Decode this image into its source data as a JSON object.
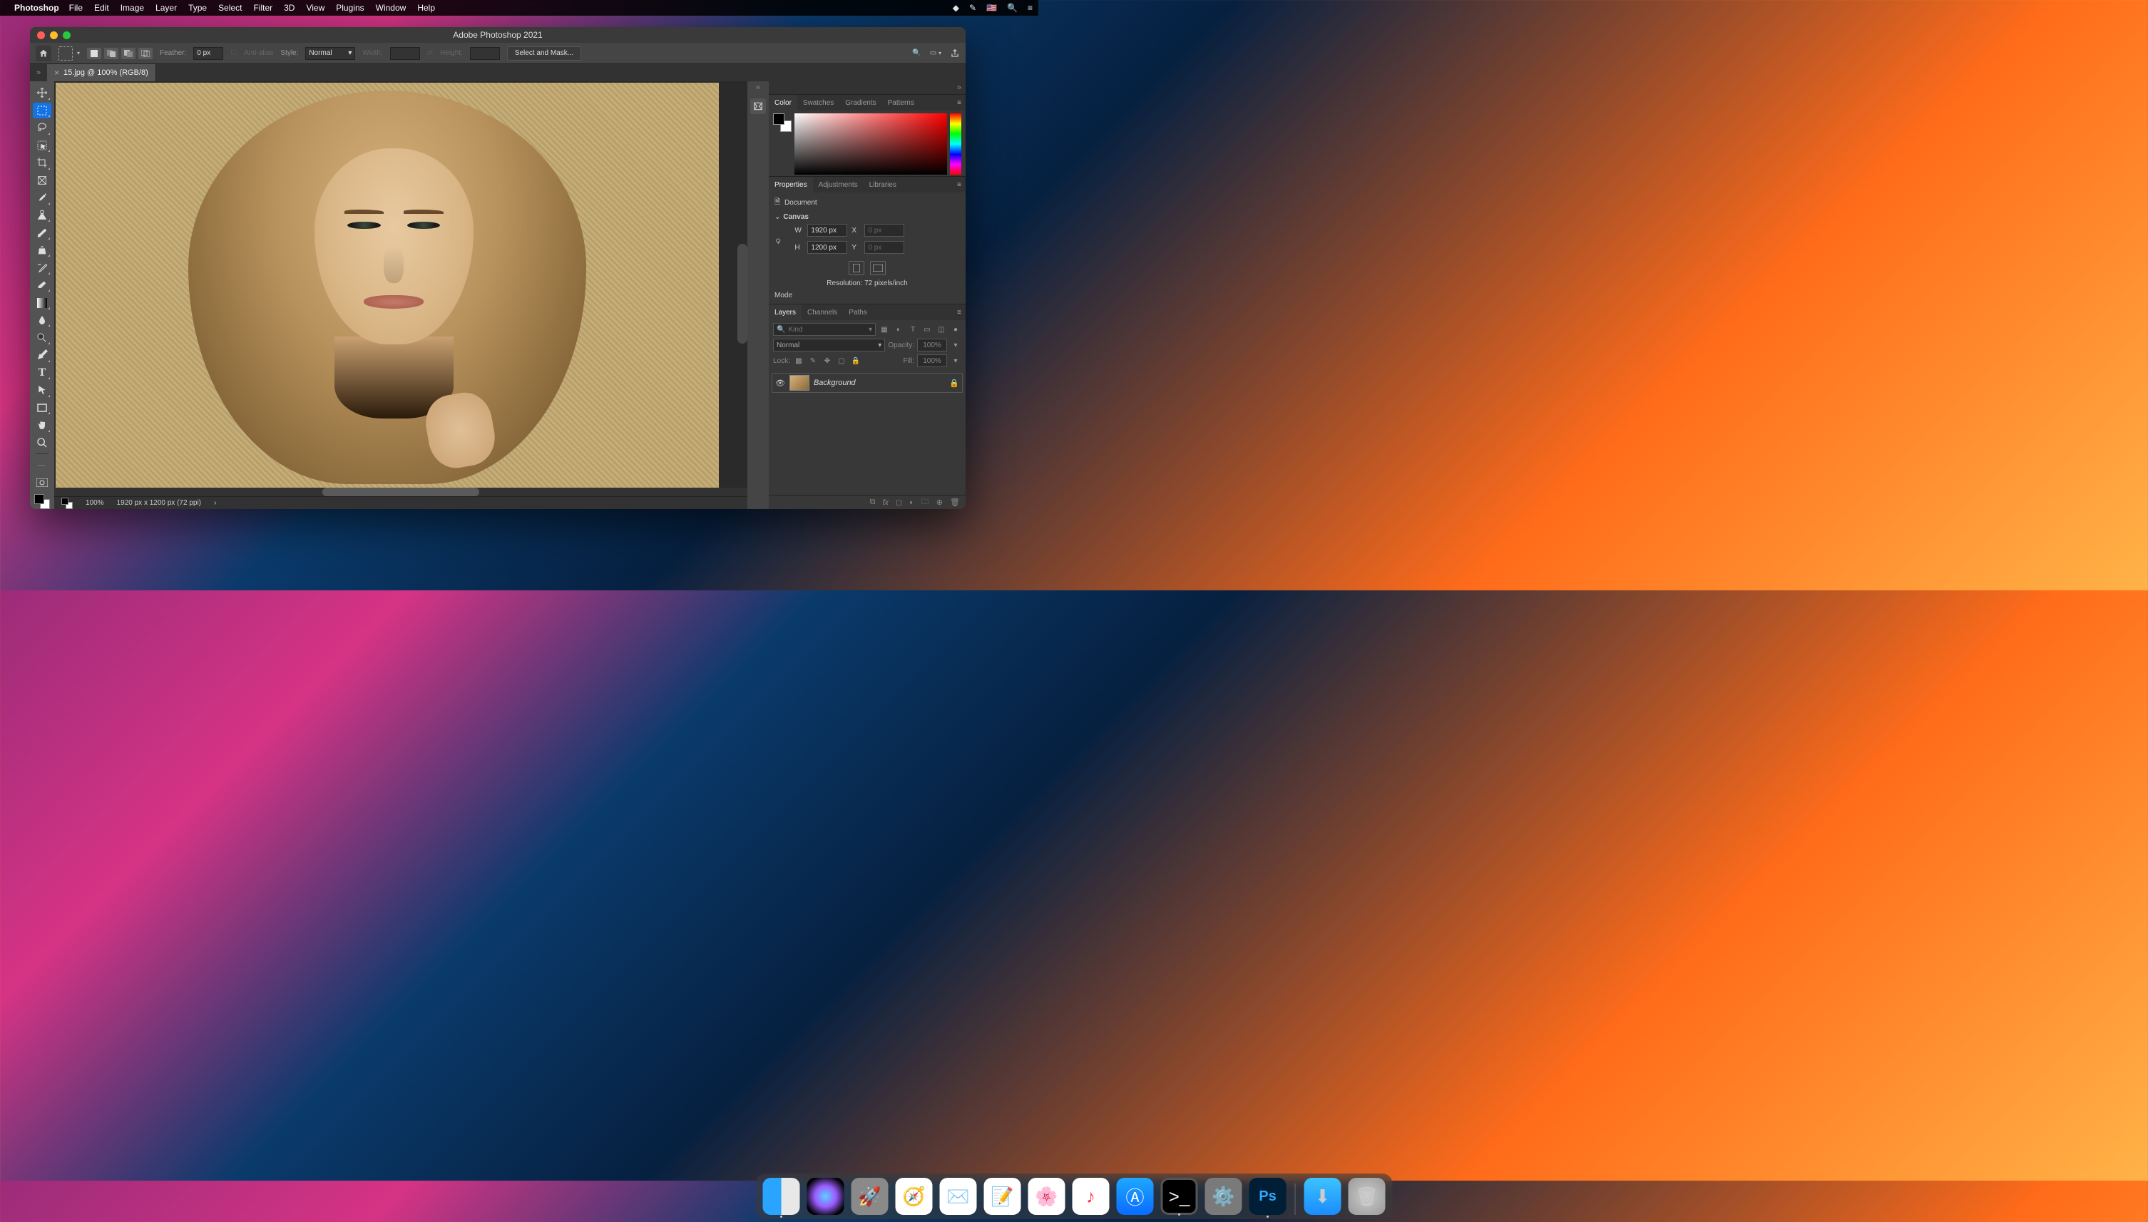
{
  "menubar": {
    "app_name": "Photoshop",
    "items": [
      "File",
      "Edit",
      "Image",
      "Layer",
      "Type",
      "Select",
      "Filter",
      "3D",
      "View",
      "Plugins",
      "Window",
      "Help"
    ]
  },
  "window": {
    "title": "Adobe Photoshop 2021"
  },
  "optionsbar": {
    "feather_label": "Feather:",
    "feather_value": "0 px",
    "antialias_label": "Anti-alias",
    "style_label": "Style:",
    "style_value": "Normal",
    "width_label": "Width:",
    "height_label": "Height:",
    "select_mask_label": "Select and Mask..."
  },
  "doctab": {
    "label": "15.jpg @ 100% (RGB/8)"
  },
  "statusbar": {
    "zoom": "100%",
    "doc_info": "1920 px x 1200 px (72 ppi)"
  },
  "panels": {
    "color_tabs": [
      "Color",
      "Swatches",
      "Gradients",
      "Patterns"
    ],
    "props_tabs": [
      "Properties",
      "Adjustments",
      "Libraries"
    ],
    "props": {
      "document_label": "Document",
      "canvas_label": "Canvas",
      "w_label": "W",
      "w_value": "1920 px",
      "h_label": "H",
      "h_value": "1200 px",
      "x_label": "X",
      "x_value": "0 px",
      "y_label": "Y",
      "y_value": "0 px",
      "resolution": "Resolution: 72 pixels/inch",
      "mode_label": "Mode"
    },
    "layers_tabs": [
      "Layers",
      "Channels",
      "Paths"
    ],
    "layers": {
      "kind_placeholder": "Kind",
      "blend_mode": "Normal",
      "opacity_label": "Opacity:",
      "opacity_value": "100%",
      "lock_label": "Lock:",
      "fill_label": "Fill:",
      "fill_value": "100%",
      "bg_layer_name": "Background"
    }
  },
  "dock": {
    "ps_label": "Ps"
  }
}
